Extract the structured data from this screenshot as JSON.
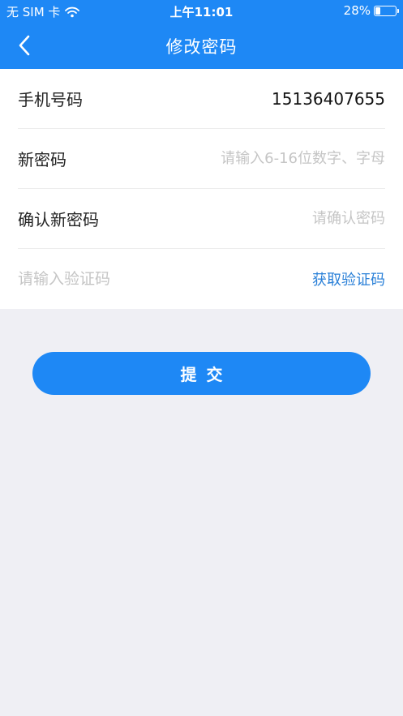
{
  "status_bar": {
    "carrier": "无 SIM 卡",
    "time": "上午11:01",
    "battery_percent_label": "28%",
    "battery_level": 0.28,
    "icons": [
      "wifi-icon",
      "battery-icon"
    ]
  },
  "nav": {
    "back_icon": "chevron-left-icon",
    "title": "修改密码"
  },
  "form": {
    "phone": {
      "label": "手机号码",
      "value": "15136407655"
    },
    "new_password": {
      "label": "新密码",
      "placeholder": "请输入6-16位数字、字母"
    },
    "confirm_password": {
      "label": "确认新密码",
      "placeholder": "请确认密码"
    },
    "verification": {
      "placeholder": "请输入验证码",
      "get_code_label": "获取验证码"
    }
  },
  "submit_label": "提交",
  "colors": {
    "primary": "#1e88f5",
    "link": "#2a80d8",
    "background": "#efeff4",
    "placeholder": "#c5c5c5"
  }
}
